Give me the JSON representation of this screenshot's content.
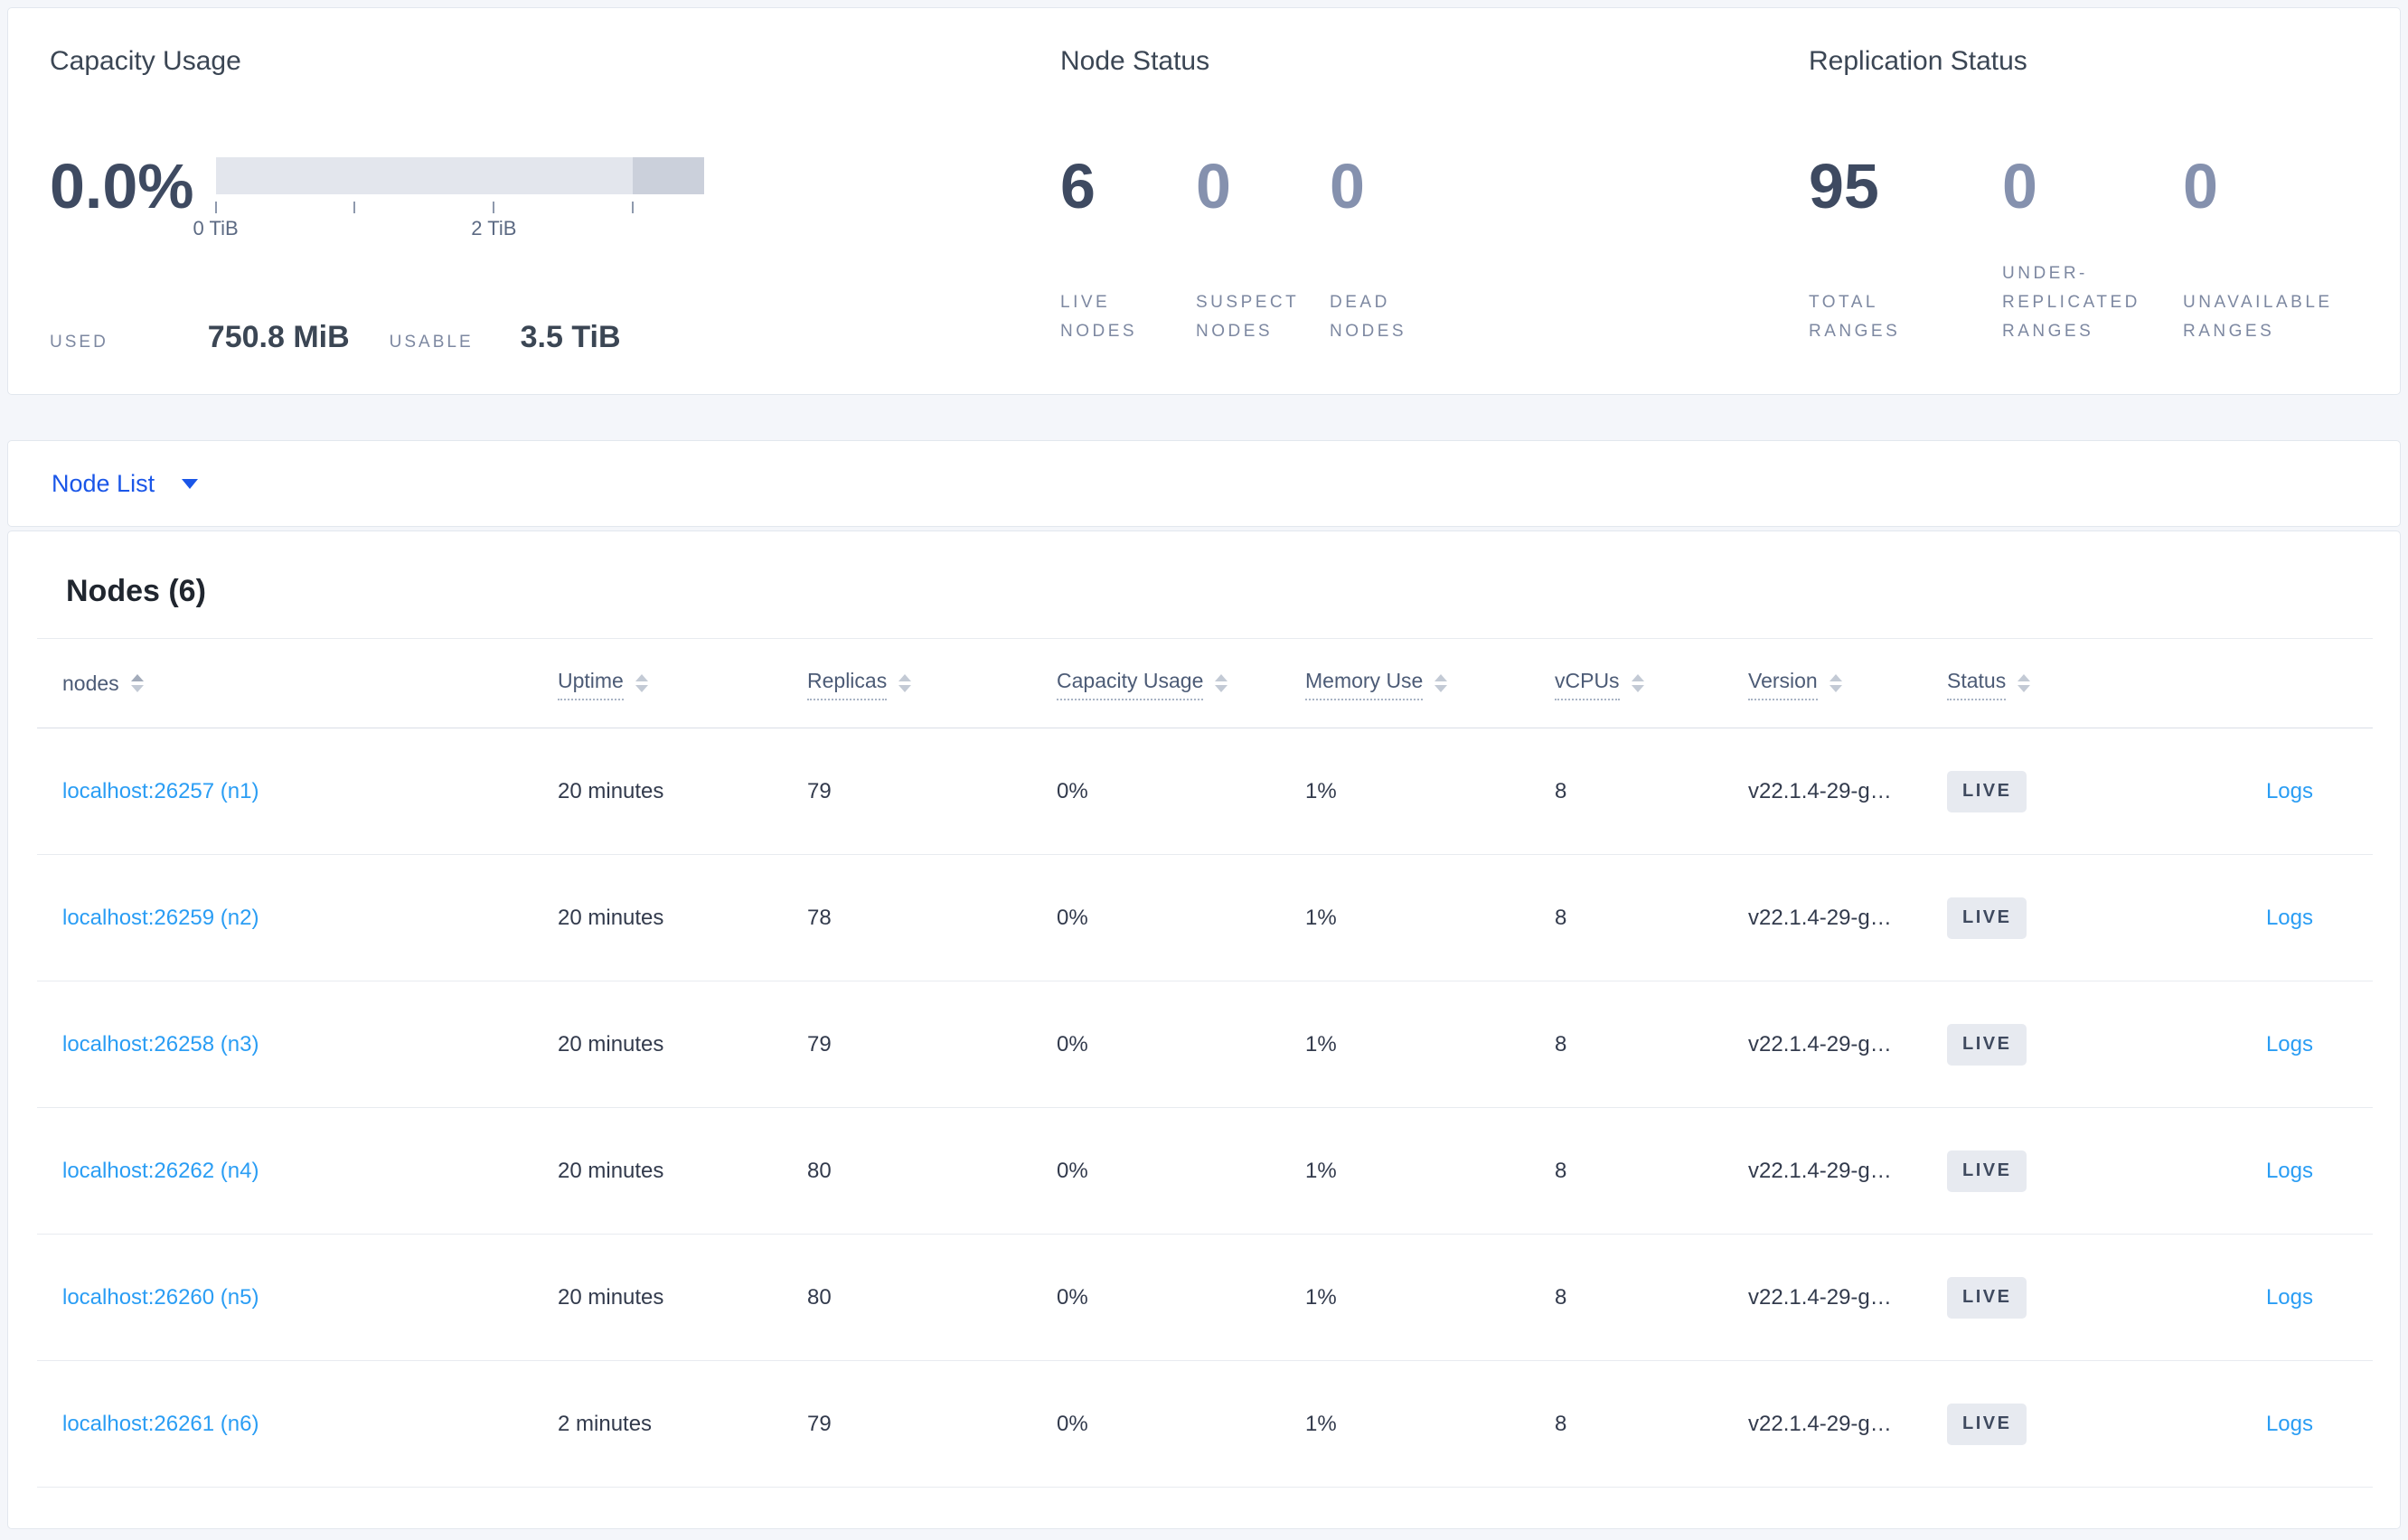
{
  "summary": {
    "capacity": {
      "title": "Capacity Usage",
      "percent": "0.0%",
      "used_label": "USED",
      "used_value": "750.8 MiB",
      "usable_label": "USABLE",
      "usable_value": "3.5 TiB",
      "bar": {
        "ticks": [
          {
            "label": "0 TiB",
            "pos": 0.0
          },
          {
            "label": "",
            "pos": 0.285
          },
          {
            "label": "2 TiB",
            "pos": 0.57
          },
          {
            "label": "",
            "pos": 0.855
          }
        ],
        "dark_segment_start": 0.855,
        "light_color": "#e3e6ed",
        "dark_color": "#cbd0db"
      }
    },
    "node_status": {
      "title": "Node Status",
      "stats": [
        {
          "value": "6",
          "label": "LIVE NODES",
          "muted": false
        },
        {
          "value": "0",
          "label": "SUSPECT NODES",
          "muted": true
        },
        {
          "value": "0",
          "label": "DEAD NODES",
          "muted": true
        }
      ]
    },
    "replication_status": {
      "title": "Replication Status",
      "stats": [
        {
          "value": "95",
          "label": "TOTAL RANGES",
          "muted": false
        },
        {
          "value": "0",
          "label": "UNDER-REPLICATED RANGES",
          "muted": true
        },
        {
          "value": "0",
          "label": "UNAVAILABLE RANGES",
          "muted": true
        }
      ]
    }
  },
  "node_list": {
    "dropdown_label": "Node List"
  },
  "nodes_section": {
    "heading": "Nodes (6)",
    "columns": [
      {
        "key": "node",
        "label": "nodes",
        "underline": false
      },
      {
        "key": "uptime",
        "label": "Uptime",
        "underline": true
      },
      {
        "key": "replicas",
        "label": "Replicas",
        "underline": true
      },
      {
        "key": "capacity",
        "label": "Capacity Usage",
        "underline": true
      },
      {
        "key": "memory",
        "label": "Memory Use",
        "underline": true
      },
      {
        "key": "vcpus",
        "label": "vCPUs",
        "underline": true
      },
      {
        "key": "version",
        "label": "Version",
        "underline": true
      },
      {
        "key": "status",
        "label": "Status",
        "underline": true
      }
    ],
    "logs_label": "Logs",
    "rows": [
      {
        "node": "localhost:26257 (n1)",
        "uptime": "20 minutes",
        "replicas": "79",
        "capacity": "0%",
        "memory": "1%",
        "vcpus": "8",
        "version": "v22.1.4-29-g…",
        "status": "LIVE"
      },
      {
        "node": "localhost:26259 (n2)",
        "uptime": "20 minutes",
        "replicas": "78",
        "capacity": "0%",
        "memory": "1%",
        "vcpus": "8",
        "version": "v22.1.4-29-g…",
        "status": "LIVE"
      },
      {
        "node": "localhost:26258 (n3)",
        "uptime": "20 minutes",
        "replicas": "79",
        "capacity": "0%",
        "memory": "1%",
        "vcpus": "8",
        "version": "v22.1.4-29-g…",
        "status": "LIVE"
      },
      {
        "node": "localhost:26262 (n4)",
        "uptime": "20 minutes",
        "replicas": "80",
        "capacity": "0%",
        "memory": "1%",
        "vcpus": "8",
        "version": "v22.1.4-29-g…",
        "status": "LIVE"
      },
      {
        "node": "localhost:26260 (n5)",
        "uptime": "20 minutes",
        "replicas": "80",
        "capacity": "0%",
        "memory": "1%",
        "vcpus": "8",
        "version": "v22.1.4-29-g…",
        "status": "LIVE"
      },
      {
        "node": "localhost:26261 (n6)",
        "uptime": "2 minutes",
        "replicas": "79",
        "capacity": "0%",
        "memory": "1%",
        "vcpus": "8",
        "version": "v22.1.4-29-g…",
        "status": "LIVE"
      }
    ]
  },
  "colors": {
    "accent_blue": "#1a56e8",
    "link_blue": "#2a9df4",
    "dark_slate": "#3e4a61",
    "muted_slate": "#8591ae"
  }
}
